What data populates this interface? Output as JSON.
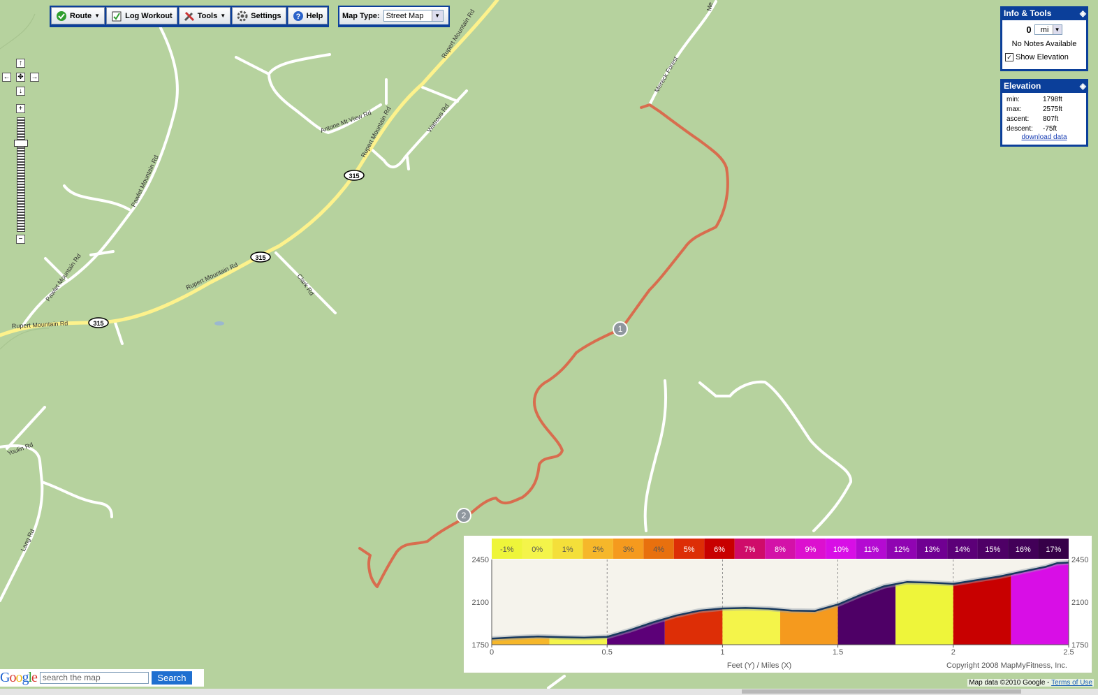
{
  "toolbar": {
    "route": "Route",
    "log_workout": "Log Workout",
    "tools": "Tools",
    "settings": "Settings",
    "help": "Help"
  },
  "map_type": {
    "label": "Map Type:",
    "value": "Street Map"
  },
  "map": {
    "roads": [
      "Rupert Mountain Rd",
      "Rupert Mountain Rd",
      "Rupert Mountain Rd",
      "Rupert Mountain Rd",
      "Antone Mt View Rd",
      "Watrous Rd",
      "Pawlet Mountain Rd",
      "Pawlet Mountain Rd",
      "Clark Rd",
      "Youlin Rd",
      "Lang Rd",
      "Mereck Forest",
      "Me"
    ],
    "shields": [
      "315",
      "315",
      "315"
    ],
    "markers": [
      "1",
      "2"
    ]
  },
  "info": {
    "title": "Info & Tools",
    "distance": "0",
    "unit": "mi",
    "notes": "No Notes Available",
    "show_elevation": "Show Elevation"
  },
  "elevation": {
    "title": "Elevation",
    "min_label": "min:",
    "min": "1798ft",
    "max_label": "max:",
    "max": "2575ft",
    "ascent_label": "ascent:",
    "ascent": "807ft",
    "descent_label": "descent:",
    "descent": "-75ft",
    "download": "download data"
  },
  "search": {
    "logo": "Google",
    "placeholder": "search the map",
    "button": "Search"
  },
  "attribution": {
    "text": "Map data ©2010 Google - ",
    "link": "Terms of Use"
  },
  "chart_data": {
    "type": "area",
    "xlabel": "Feet (Y) / Miles (X)",
    "copyright": "Copyright 2008 MapMyFitness, Inc.",
    "xlim": [
      0,
      2.5
    ],
    "ylim": [
      1750,
      2450
    ],
    "x_ticks": [
      "0",
      "0.5",
      "1",
      "1.5",
      "2",
      "2.5"
    ],
    "y_ticks": [
      "1750",
      "2100",
      "2450"
    ],
    "grade_legend": [
      {
        "label": "-1%",
        "color": "#eef53a"
      },
      {
        "label": "0%",
        "color": "#f4f44a"
      },
      {
        "label": "1%",
        "color": "#f4df3a"
      },
      {
        "label": "2%",
        "color": "#f6b72a"
      },
      {
        "label": "3%",
        "color": "#f59a1e"
      },
      {
        "label": "4%",
        "color": "#e8700e"
      },
      {
        "label": "5%",
        "color": "#dd2e06"
      },
      {
        "label": "6%",
        "color": "#c80000"
      },
      {
        "label": "7%",
        "color": "#cf0c6a"
      },
      {
        "label": "8%",
        "color": "#d312a8"
      },
      {
        "label": "9%",
        "color": "#dc10cf"
      },
      {
        "label": "10%",
        "color": "#d80ee6"
      },
      {
        "label": "11%",
        "color": "#b40ad2"
      },
      {
        "label": "12%",
        "color": "#9004b2"
      },
      {
        "label": "13%",
        "color": "#700092"
      },
      {
        "label": "14%",
        "color": "#5c0078"
      },
      {
        "label": "15%",
        "color": "#4e0066"
      },
      {
        "label": "16%",
        "color": "#420058"
      },
      {
        "label": "17%",
        "color": "#360048"
      }
    ],
    "profile": {
      "x": [
        0,
        0.1,
        0.2,
        0.3,
        0.4,
        0.5,
        0.6,
        0.7,
        0.8,
        0.9,
        1.0,
        1.1,
        1.2,
        1.3,
        1.4,
        1.5,
        1.6,
        1.7,
        1.8,
        1.9,
        2.0,
        2.1,
        2.2,
        2.3,
        2.4,
        2.45,
        2.5
      ],
      "y": [
        1800,
        1810,
        1817,
        1812,
        1808,
        1815,
        1870,
        1935,
        1990,
        2030,
        2048,
        2052,
        2046,
        2030,
        2027,
        2080,
        2160,
        2230,
        2265,
        2260,
        2250,
        2280,
        2310,
        2350,
        2390,
        2420,
        2425
      ]
    },
    "grade_segments": [
      {
        "from": 0,
        "to": 0.25,
        "color": "#f6b72a"
      },
      {
        "from": 0.25,
        "to": 0.5,
        "color": "#f4f44a"
      },
      {
        "from": 0.5,
        "to": 0.75,
        "color": "#5c0078"
      },
      {
        "from": 0.75,
        "to": 1.0,
        "color": "#dd2e06"
      },
      {
        "from": 1.0,
        "to": 1.25,
        "color": "#f4f44a"
      },
      {
        "from": 1.25,
        "to": 1.5,
        "color": "#f59a1e"
      },
      {
        "from": 1.5,
        "to": 1.75,
        "color": "#4e0066"
      },
      {
        "from": 1.75,
        "to": 2.0,
        "color": "#eef53a"
      },
      {
        "from": 2.0,
        "to": 2.25,
        "color": "#c80000"
      },
      {
        "from": 2.25,
        "to": 2.5,
        "color": "#d80ee6"
      }
    ]
  }
}
